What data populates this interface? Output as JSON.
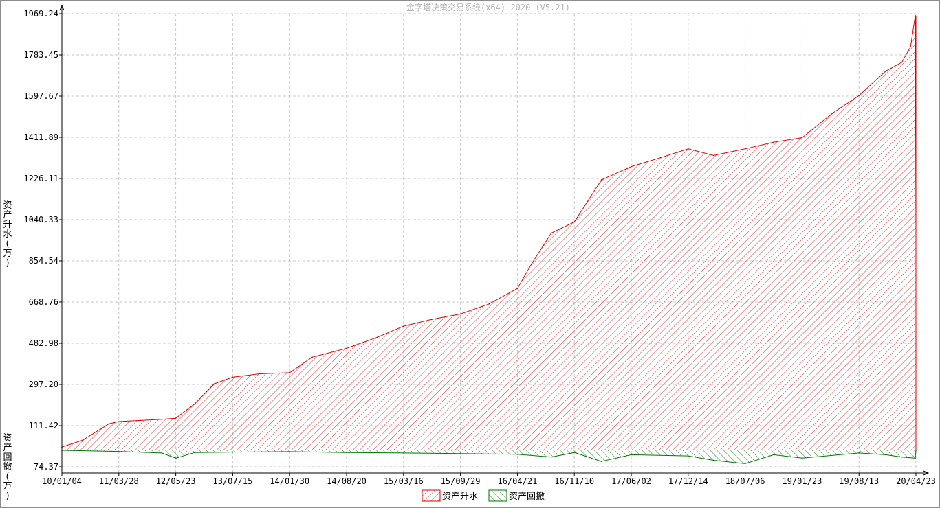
{
  "chart_data": {
    "type": "area",
    "title": "金字塔决策交易系统(x64) 2020 (V5.21)",
    "ylabel_top": "资产升水(万)",
    "ylabel_bottom": "资产回撤(万)",
    "y_ticks": [
      "1969.24",
      "1783.45",
      "1597.67",
      "1411.89",
      "1226.11",
      "1040.33",
      "854.54",
      "668.76",
      "482.98",
      "297.20",
      "111.42",
      "-74.37"
    ],
    "ylim": [
      -74.37,
      1969.24
    ],
    "x_ticks": [
      "10/01/04",
      "11/03/28",
      "12/05/23",
      "13/07/15",
      "14/01/30",
      "14/08/20",
      "15/03/16",
      "15/09/29",
      "16/04/21",
      "16/11/10",
      "17/06/02",
      "17/12/14",
      "18/07/06",
      "19/01/23",
      "19/08/13",
      "20/04/23"
    ],
    "grid": true,
    "legend_placement": "bottom-center",
    "series": [
      {
        "name": "资产升水",
        "color": "#e00000",
        "x": [
          "10/01/04",
          "10/06/15",
          "11/01/10",
          "11/03/28",
          "11/09/05",
          "12/02/10",
          "12/05/23",
          "12/10/10",
          "13/03/01",
          "13/07/15",
          "13/10/15",
          "14/01/30",
          "14/04/20",
          "14/08/20",
          "14/12/10",
          "15/03/16",
          "15/06/20",
          "15/09/29",
          "16/01/10",
          "16/04/21",
          "16/06/10",
          "16/08/20",
          "16/11/10",
          "17/02/15",
          "17/06/02",
          "17/09/10",
          "17/12/14",
          "18/03/15",
          "18/07/06",
          "18/10/15",
          "19/01/23",
          "19/05/10",
          "19/08/13",
          "19/12/10",
          "20/02/20",
          "20/03/30",
          "20/04/20",
          "20/04/23"
        ],
        "values": [
          15,
          45,
          120,
          130,
          135,
          140,
          145,
          210,
          300,
          330,
          345,
          350,
          420,
          460,
          510,
          560,
          590,
          615,
          660,
          730,
          840,
          980,
          1030,
          1220,
          1280,
          1320,
          1360,
          1330,
          1360,
          1390,
          1410,
          1520,
          1600,
          1710,
          1750,
          1820,
          1960,
          980
        ]
      },
      {
        "name": "资产回撤",
        "color": "#007800",
        "x": [
          "10/01/04",
          "11/03/28",
          "12/02/10",
          "12/05/23",
          "12/10/10",
          "13/07/15",
          "14/01/30",
          "14/08/20",
          "15/03/16",
          "15/09/29",
          "16/04/21",
          "16/08/20",
          "16/11/10",
          "17/02/15",
          "17/06/02",
          "17/12/14",
          "18/03/15",
          "18/07/06",
          "18/10/15",
          "19/01/23",
          "19/08/13",
          "19/12/10",
          "20/02/20",
          "20/04/20",
          "20/04/23"
        ],
        "values": [
          0,
          -5,
          -12,
          -35,
          -10,
          -8,
          -6,
          -10,
          -12,
          -15,
          -18,
          -30,
          -10,
          -50,
          -20,
          -25,
          -45,
          -60,
          -20,
          -35,
          -12,
          -20,
          -30,
          -35,
          0
        ]
      }
    ]
  }
}
